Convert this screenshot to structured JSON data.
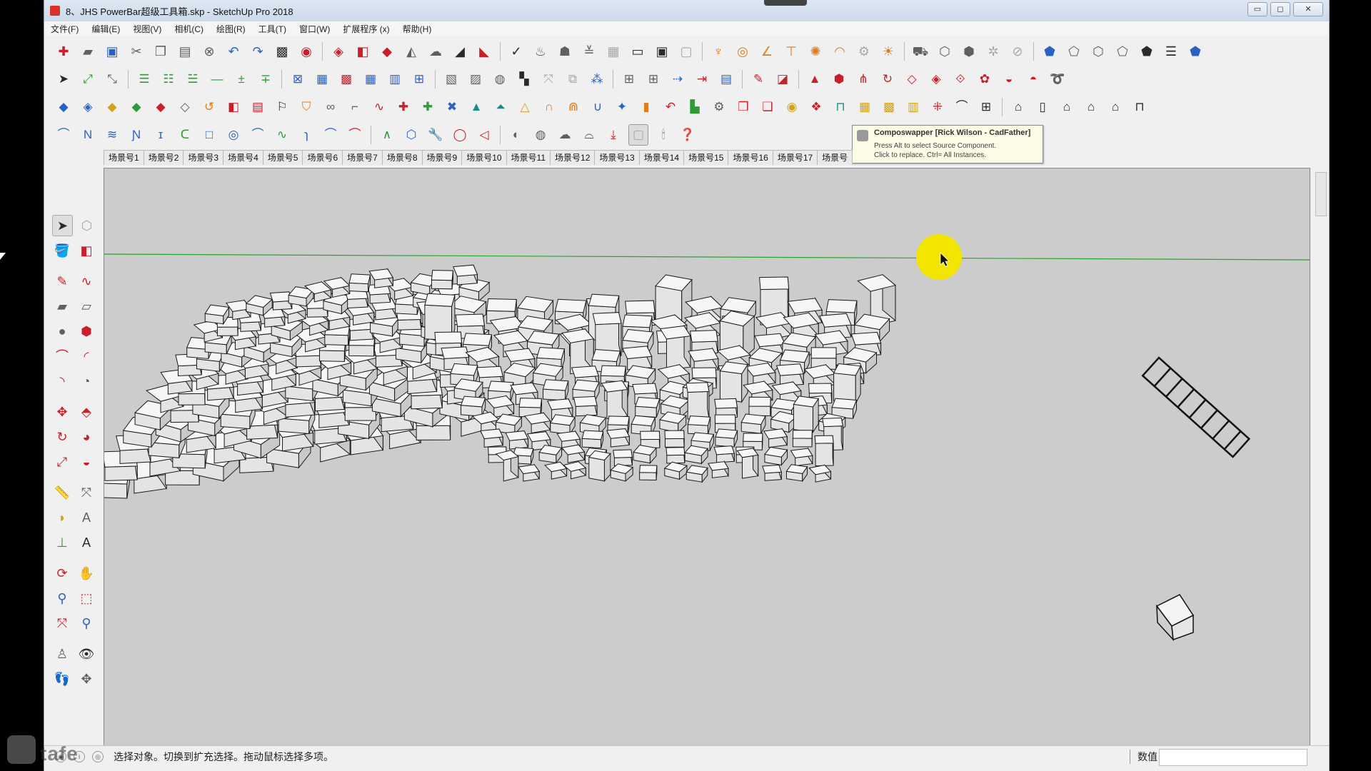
{
  "window": {
    "title": "8、JHS PowerBar超级工具箱.skp - SketchUp Pro 2018",
    "min_label": "▭",
    "restore_label": "◻",
    "close_label": "✕"
  },
  "menu": [
    "文件(F)",
    "编辑(E)",
    "视图(V)",
    "相机(C)",
    "绘图(R)",
    "工具(T)",
    "窗口(W)",
    "扩展程序 (x)",
    "帮助(H)"
  ],
  "scene_tabs": [
    "场景号1",
    "场景号2",
    "场景号3",
    "场景号4",
    "场景号5",
    "场景号6",
    "场景号7",
    "场景号8",
    "场景号9",
    "场景号10",
    "场景号11",
    "场景号12",
    "场景号13",
    "场景号14",
    "场景号15",
    "场景号16",
    "场景号17",
    "场景号"
  ],
  "tooltip": {
    "title": "Composwapper [Rick Wilson - CadFather]",
    "line1": "Press Alt to select Source Component.",
    "line2": "Click to replace.  Ctrl= All Instances."
  },
  "status": {
    "text": "选择对象。切换到扩充选择。拖动鼠标选择多项。",
    "measurements_label": "数值",
    "measurements_value": ""
  },
  "colors": {
    "viewport_bg": "#cccccc",
    "horizon_line": "#2aa52a",
    "cursor_highlight": "#f2e600",
    "ui_bg": "#f0f0f0"
  },
  "watermark": "tafe"
}
